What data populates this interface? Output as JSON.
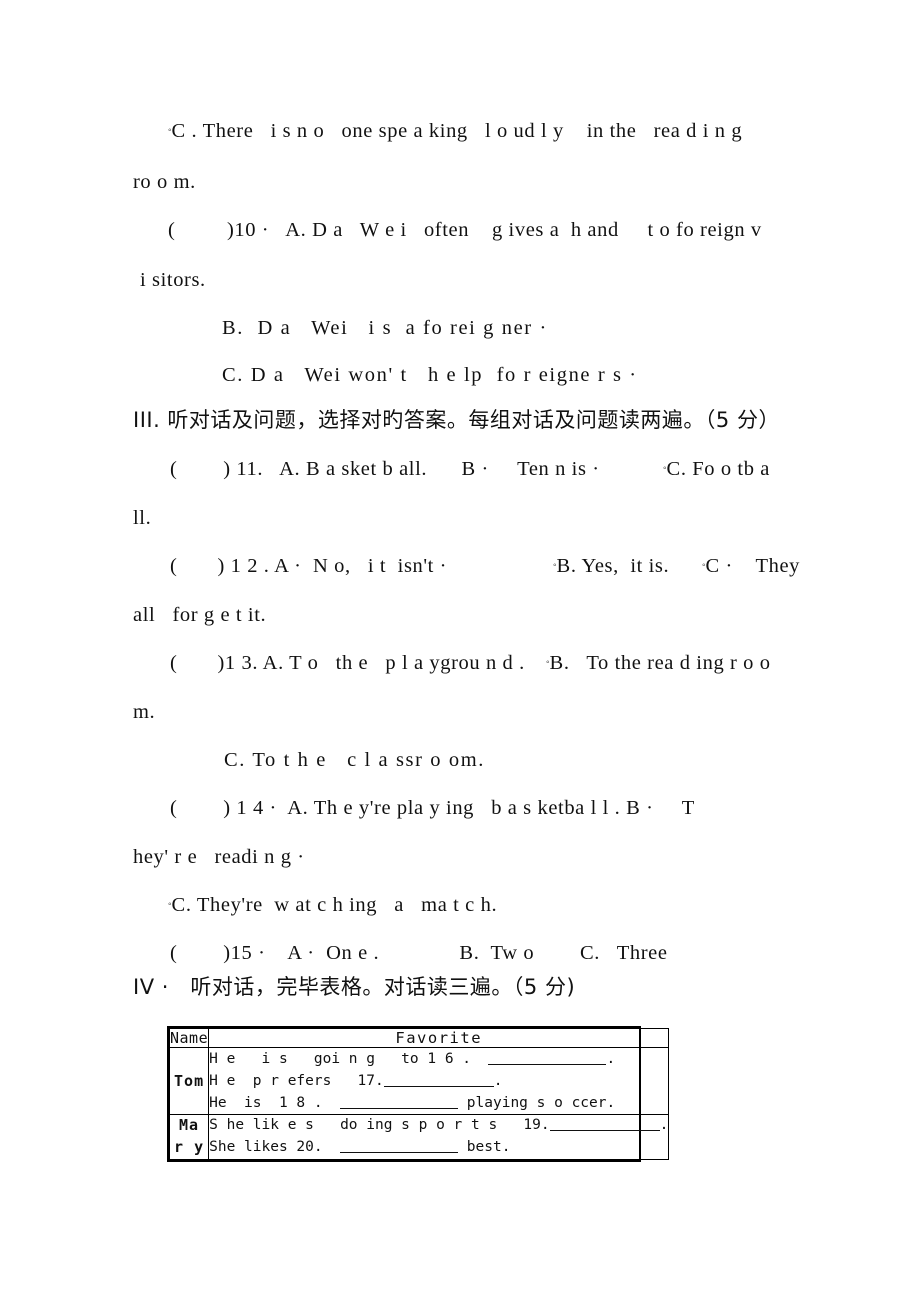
{
  "document": {
    "type": "scanned-exam-paper",
    "language": "zh-en",
    "page_background": "#ffffff",
    "text_color": "#111111"
  },
  "body_lines": [
    {
      "id": "l1",
      "text": "C . There   i s n o   one spe a king   l o ud l y    in the   rea d i n g"
    },
    {
      "id": "l2",
      "text": "ro o m."
    },
    {
      "id": "l3",
      "text": "(         )10 ·   A. D a   W e i   often    g ives a  h and     t o fo reign v"
    },
    {
      "id": "l4",
      "text": "i sitors."
    },
    {
      "id": "l5",
      "text": "B.  D a   Wei   i s  a fo rei g ner ·"
    },
    {
      "id": "l6",
      "text": "C. D a   Wei won' t   h e lp  fo r eigne r s ·"
    },
    {
      "id": "l7",
      "text": "III. 听对话及问题，选择对旳答案。每组对话及问题读两遍。（5 分）"
    },
    {
      "id": "l8",
      "text": "(        ) 11.   A. B a sket b all.      B ·     Ten n is ·"
    },
    {
      "id": "l8b",
      "text": "C. Fo o tb a"
    },
    {
      "id": "l9",
      "text": "ll."
    },
    {
      "id": "l10",
      "text": "(       ) 1 2 . A ·  N o,   i t  isn't ·"
    },
    {
      "id": "l10b",
      "text": "B. Yes,  it is."
    },
    {
      "id": "l10c",
      "text": "C ·    They"
    },
    {
      "id": "l11",
      "text": "all   for g e t it."
    },
    {
      "id": "l12",
      "text": "(       )1 3. A. T o   th e   p l a ygrou n d ."
    },
    {
      "id": "l12b",
      "text": "B.   To the rea d ing r o o"
    },
    {
      "id": "l13",
      "text": "m."
    },
    {
      "id": "l14",
      "text": "C. To t h e   c l a ssr o om."
    },
    {
      "id": "l15",
      "text": "(        ) 1 4 ·  A. Th e y're pla y ing   b a s ketba l l . B ·     T"
    },
    {
      "id": "l16",
      "text": "hey' r e   readi n g ·"
    },
    {
      "id": "l17",
      "text": "C. They're  w at c h ing   a   ma t c h."
    },
    {
      "id": "l18",
      "text": "(        )15 ·    A ·  On e .              B.  Tw o        C.   Three"
    },
    {
      "id": "l19",
      "text": "IV ·   听对话，完毕表格。对话读三遍。（5 分)"
    }
  ],
  "table": {
    "name": "favorite-table",
    "headers": {
      "name": "Name",
      "favorite": "Favorite"
    },
    "rows": [
      {
        "name": "Tom",
        "name_lines": [
          "Tom"
        ],
        "lines": [
          {
            "pre": "H e   i s   goi n g   to 1 6 .  ",
            "blank_width": 118,
            "post": "."
          },
          {
            "pre": "H e  p r efers   17.",
            "blank_width": 110,
            "post": "."
          },
          {
            "pre": "He  is  1 8 .  ",
            "blank_width": 118,
            "post": " playing s o ccer."
          }
        ]
      },
      {
        "name": "Mary",
        "name_lines": [
          "Ma",
          "r y"
        ],
        "lines": [
          {
            "pre": "S he lik e s   do ing s p o r t s   19.",
            "blank_width": 110,
            "post": "."
          },
          {
            "pre": "She likes 20.  ",
            "blank_width": 118,
            "post": " best."
          }
        ]
      }
    ]
  }
}
